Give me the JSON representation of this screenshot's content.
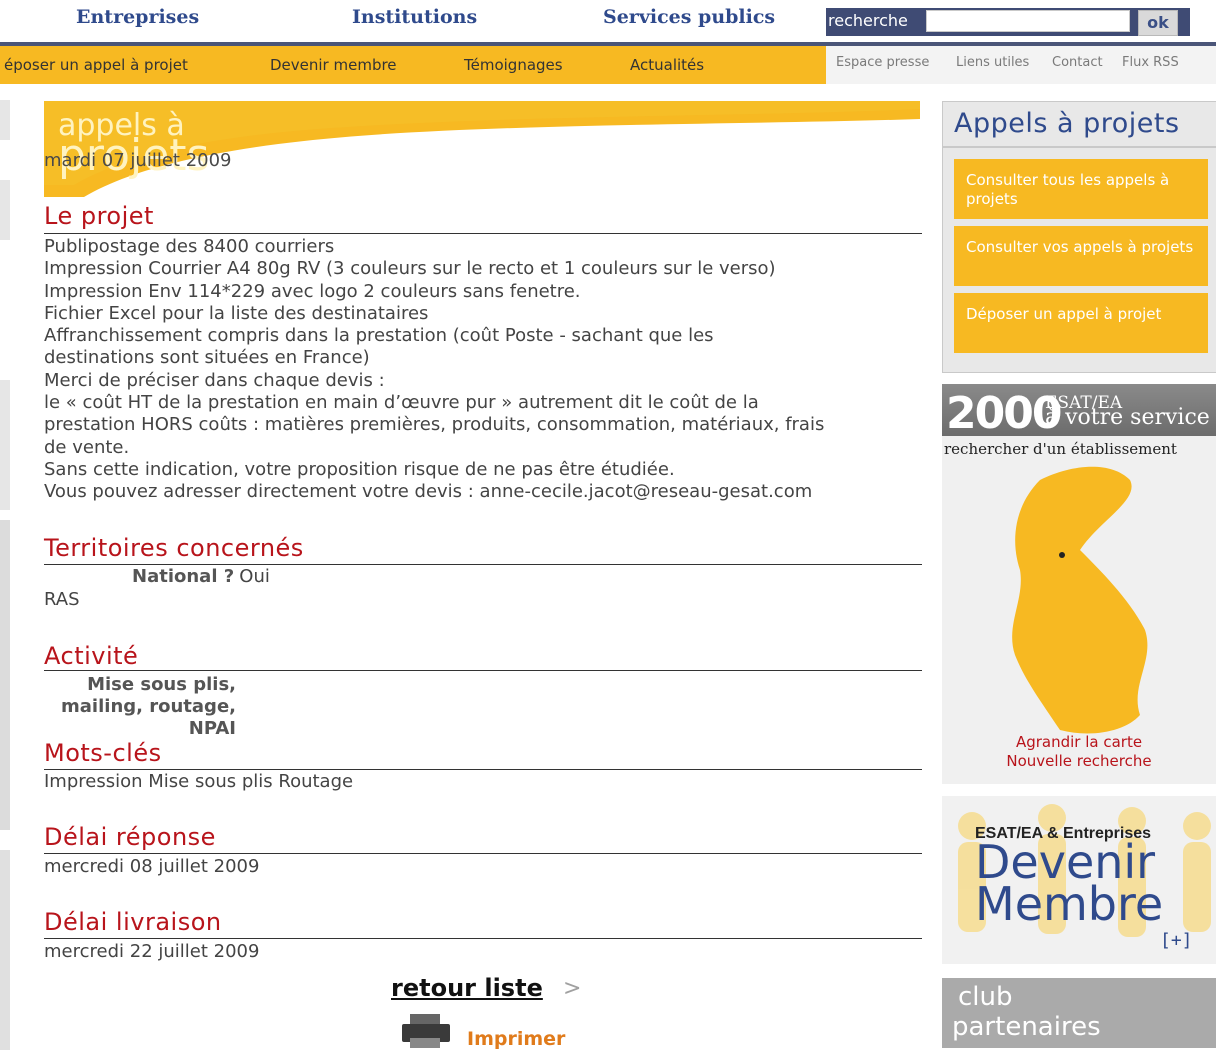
{
  "topnav": {
    "entreprises": "Entreprises",
    "institutions": "Institutions",
    "services": "Services publics"
  },
  "search": {
    "label": "recherche",
    "value": "",
    "ok": "ok"
  },
  "subnav": {
    "deposer": "époser un appel à projet",
    "devenir": "Devenir membre",
    "temoignages": "Témoignages",
    "actualites": "Actualités"
  },
  "utility": {
    "presse": "Espace presse",
    "liens": "Liens utiles",
    "contact": "Contact",
    "rss": "Flux RSS"
  },
  "banner": {
    "word1": "appels à",
    "word2": "projets"
  },
  "date": "mardi 07 juillet 2009",
  "projet": {
    "title": "Le projet",
    "text": "Publipostage des 8400 courriers\nImpression Courrier A4 80g RV (3 couleurs sur le recto et 1 couleurs sur le verso)\nImpression Env 114*229 avec logo 2 couleurs sans fenetre.\nFichier Excel pour la liste des destinataires\nAffranchissement compris dans la prestation (coût Poste - sachant que les\ndestinations sont situées en France)\nMerci de préciser dans chaque devis :\nle « coût HT de la prestation en main d’œuvre pur » autrement dit le coût de la\nprestation HORS coûts : matières premières, produits, consommation, matériaux, frais\nde vente.\nSans cette indication, votre proposition risque de ne pas être étudiée.\nVous pouvez adresser directement votre devis : anne-cecile.jacot@reseau-gesat.com"
  },
  "territoires": {
    "title": "Territoires concernés",
    "national_label": "National ?",
    "national_value": "Oui",
    "ras": "RAS"
  },
  "activite": {
    "title": "Activité",
    "line1": "Mise sous plis,",
    "line2": "mailing, routage,",
    "line3": "NPAI"
  },
  "mots": {
    "title": "Mots-clés",
    "value": "Impression Mise sous plis Routage"
  },
  "delai_reponse": {
    "title": "Délai réponse",
    "value": "mercredi 08 juillet 2009"
  },
  "delai_livraison": {
    "title": "Délai livraison",
    "value": "mercredi 22 juillet 2009"
  },
  "retour": "retour liste",
  "retour_arrow": ">",
  "imprimer": "Imprimer",
  "right": {
    "appels_title": "Appels à projets",
    "btn1": "Consulter tous les appels à projets",
    "btn2": "Consulter vos appels à projets",
    "btn3": "Déposer un appel à projet",
    "big": "2000",
    "esatea": "ESAT/EA",
    "votre_service": "à votre service",
    "rechercher": "rechercher d'un établissement",
    "agrandir": "Agrandir la carte",
    "nouvelle": "Nouvelle recherche",
    "membre_small": "ESAT/EA & Entreprises",
    "membre_big1": "Devenir",
    "membre_big2": "Membre",
    "membre_plus": "[+]",
    "club1": "club",
    "club2": "partenaires"
  },
  "colors": {
    "yellow": "#f7b922",
    "navy": "#2f4a8c",
    "red": "#b8141b",
    "orange": "#e07b1b"
  }
}
